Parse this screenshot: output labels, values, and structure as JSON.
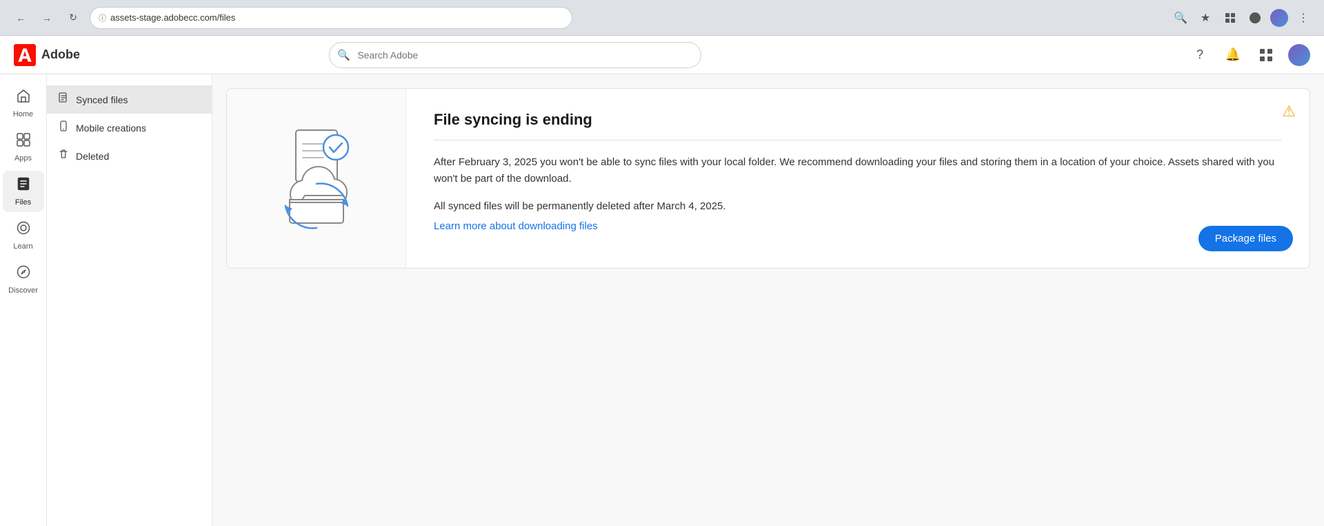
{
  "browser": {
    "url": "assets-stage.adobecc.com/files",
    "back_title": "Back",
    "forward_title": "Forward",
    "reload_title": "Reload"
  },
  "header": {
    "logo_text": "Adobe",
    "search_placeholder": "Search Adobe"
  },
  "sidebar": {
    "items": [
      {
        "id": "home",
        "label": "Home",
        "icon": "⌂"
      },
      {
        "id": "apps",
        "label": "Apps",
        "icon": "⊞"
      },
      {
        "id": "files",
        "label": "Files",
        "icon": "▣",
        "active": true
      },
      {
        "id": "learn",
        "label": "Learn",
        "icon": "◎"
      },
      {
        "id": "discover",
        "label": "Discover",
        "icon": "⊙"
      }
    ]
  },
  "sub_sidebar": {
    "items": [
      {
        "id": "synced-files",
        "label": "Synced files",
        "icon": "📄",
        "active": true
      },
      {
        "id": "mobile-creations",
        "label": "Mobile creations",
        "icon": "📱"
      },
      {
        "id": "deleted",
        "label": "Deleted",
        "icon": "🗑"
      }
    ]
  },
  "notice": {
    "title": "File syncing is ending",
    "divider": true,
    "body1": "After February 3, 2025 you won't be able to sync files with your local folder. We recommend downloading your files and storing them in a location of your choice. Assets shared with you won't be part of the download.",
    "body2": "All synced files will be permanently deleted after March 4, 2025.",
    "link_text": "Learn more about downloading files",
    "link_href": "#",
    "package_btn_label": "Package files",
    "warning_icon": "⚠"
  }
}
